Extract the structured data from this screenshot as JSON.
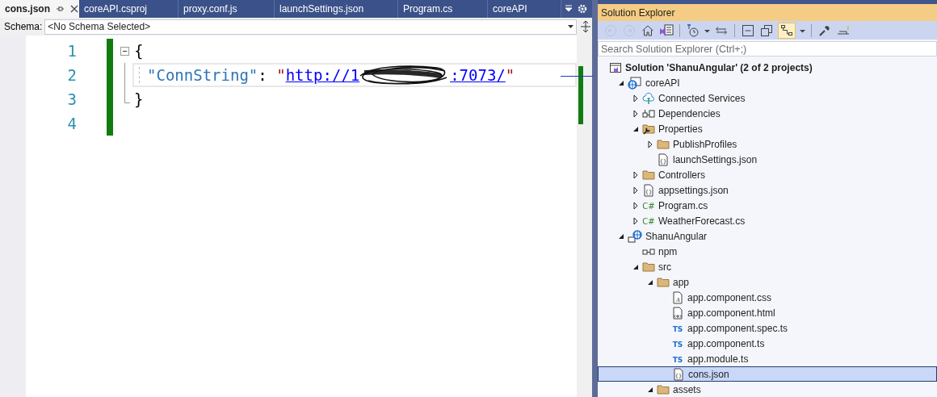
{
  "editor": {
    "tabs": [
      {
        "label": "cons.json",
        "selected": true
      },
      {
        "label": "coreAPI.csproj",
        "selected": false
      },
      {
        "label": "proxy.conf.js",
        "selected": false
      },
      {
        "label": "launchSettings.json",
        "selected": false
      },
      {
        "label": "Program.cs",
        "selected": false
      },
      {
        "label": "coreAPI",
        "selected": false
      }
    ],
    "schema": {
      "label": "Schema:",
      "value": "<No Schema Selected>"
    },
    "lines": [
      {
        "number": "1",
        "current": false,
        "kind": "start",
        "tokens": [
          {
            "kind": "punct",
            "text": "{"
          }
        ]
      },
      {
        "number": "2",
        "current": true,
        "kind": "inner",
        "tokens": [
          {
            "kind": "key",
            "text": "\"ConnString\""
          },
          {
            "kind": "punct",
            "text": ": "
          },
          {
            "kind": "string",
            "text": "\""
          },
          {
            "kind": "url",
            "text": "http://1"
          },
          {
            "kind": "redaction"
          },
          {
            "kind": "url",
            "text": ":7073/"
          },
          {
            "kind": "string",
            "text": "\""
          }
        ]
      },
      {
        "number": "3",
        "current": false,
        "kind": "end",
        "tokens": [
          {
            "kind": "punct",
            "text": "}"
          }
        ]
      },
      {
        "number": "4",
        "current": false,
        "kind": "plain"
      }
    ]
  },
  "solution_explorer": {
    "title": "Solution Explorer",
    "toolbar": [
      {
        "kind": "back",
        "selected": false,
        "disabled": true
      },
      {
        "kind": "forward",
        "selected": false,
        "disabled": true
      },
      {
        "kind": "home",
        "selected": false,
        "disabled": false
      },
      {
        "kind": "switch-views",
        "selected": false,
        "disabled": false
      },
      {
        "kind": "pending-changes",
        "selected": false,
        "disabled": false
      },
      {
        "kind": "dropdown",
        "selected": false,
        "disabled": false
      },
      {
        "kind": "sync",
        "selected": false,
        "disabled": false
      },
      {
        "kind": "collapse",
        "selected": false,
        "disabled": false
      },
      {
        "kind": "show-all",
        "selected": false,
        "disabled": false
      },
      {
        "kind": "tree-view",
        "selected": true,
        "disabled": false
      },
      {
        "kind": "dropdown",
        "selected": false,
        "disabled": false
      },
      {
        "kind": "properties",
        "selected": false,
        "disabled": false
      },
      {
        "kind": "preview",
        "selected": false,
        "disabled": false
      }
    ],
    "search": {
      "placeholder": "Search Solution Explorer (Ctrl+;)"
    },
    "solution": {
      "label": "Solution 'ShanuAngular' (2 of 2 projects)"
    },
    "tree": [
      {
        "label": "coreAPI",
        "kind": "web-project",
        "expanded": true,
        "selected": false,
        "children": [
          {
            "label": "Connected Services",
            "kind": "connected",
            "expanded": false,
            "selected": false
          },
          {
            "label": "Dependencies",
            "kind": "dependencies",
            "expanded": false,
            "selected": false
          },
          {
            "label": "Properties",
            "kind": "properties",
            "expanded": true,
            "selected": false,
            "children": [
              {
                "label": "PublishProfiles",
                "kind": "folder",
                "expanded": false,
                "selected": false
              },
              {
                "label": "launchSettings.json",
                "kind": "json",
                "icon_text": "{}",
                "selected": false
              }
            ]
          },
          {
            "label": "Controllers",
            "kind": "folder",
            "expanded": false,
            "selected": false
          },
          {
            "label": "appsettings.json",
            "kind": "json",
            "icon_text": "{}",
            "expanded": false,
            "selected": false
          },
          {
            "label": "Program.cs",
            "kind": "csharp",
            "icon_text": "C#",
            "expanded": false,
            "selected": false
          },
          {
            "label": "WeatherForecast.cs",
            "kind": "csharp",
            "icon_text": "C#",
            "expanded": false,
            "selected": false
          }
        ]
      },
      {
        "label": "ShanuAngular",
        "kind": "web-site",
        "expanded": true,
        "selected": false,
        "children": [
          {
            "label": "npm",
            "kind": "npm",
            "selected": false
          },
          {
            "label": "src",
            "kind": "folder",
            "expanded": true,
            "selected": false,
            "children": [
              {
                "label": "app",
                "kind": "folder",
                "expanded": true,
                "selected": false,
                "children": [
                  {
                    "label": "app.component.css",
                    "kind": "css",
                    "icon_text": "A",
                    "selected": false
                  },
                  {
                    "label": "app.component.html",
                    "kind": "html",
                    "selected": false
                  },
                  {
                    "label": "app.component.spec.ts",
                    "kind": "ts",
                    "icon_text": "TS",
                    "selected": false
                  },
                  {
                    "label": "app.component.ts",
                    "kind": "ts",
                    "icon_text": "TS",
                    "selected": false
                  },
                  {
                    "label": "app.module.ts",
                    "kind": "ts",
                    "icon_text": "TS",
                    "selected": false
                  },
                  {
                    "label": "cons.json",
                    "kind": "json",
                    "icon_text": "{}",
                    "selected": true
                  }
                ]
              },
              {
                "label": "assets",
                "kind": "folder",
                "expanded": true,
                "selected": false
              }
            ]
          }
        ]
      }
    ]
  }
}
